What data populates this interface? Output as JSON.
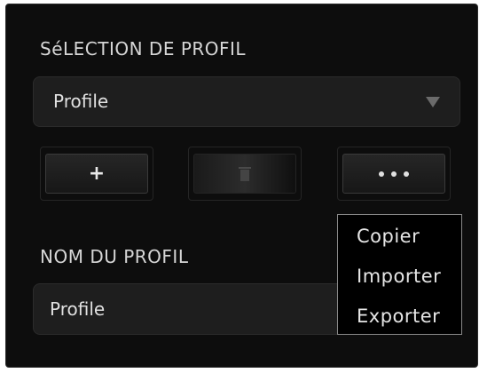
{
  "profile_selection": {
    "title": "SéLECTION DE PROFIL",
    "selected_value": "Profile"
  },
  "buttons": {
    "add_label": "+",
    "delete_icon": "trash-icon",
    "more_icon": "ellipsis-icon"
  },
  "profile_name": {
    "title": "NOM DU PROFIL",
    "value": "Profile"
  },
  "context_menu": {
    "items": [
      "Copier",
      "Importer",
      "Exporter"
    ]
  }
}
